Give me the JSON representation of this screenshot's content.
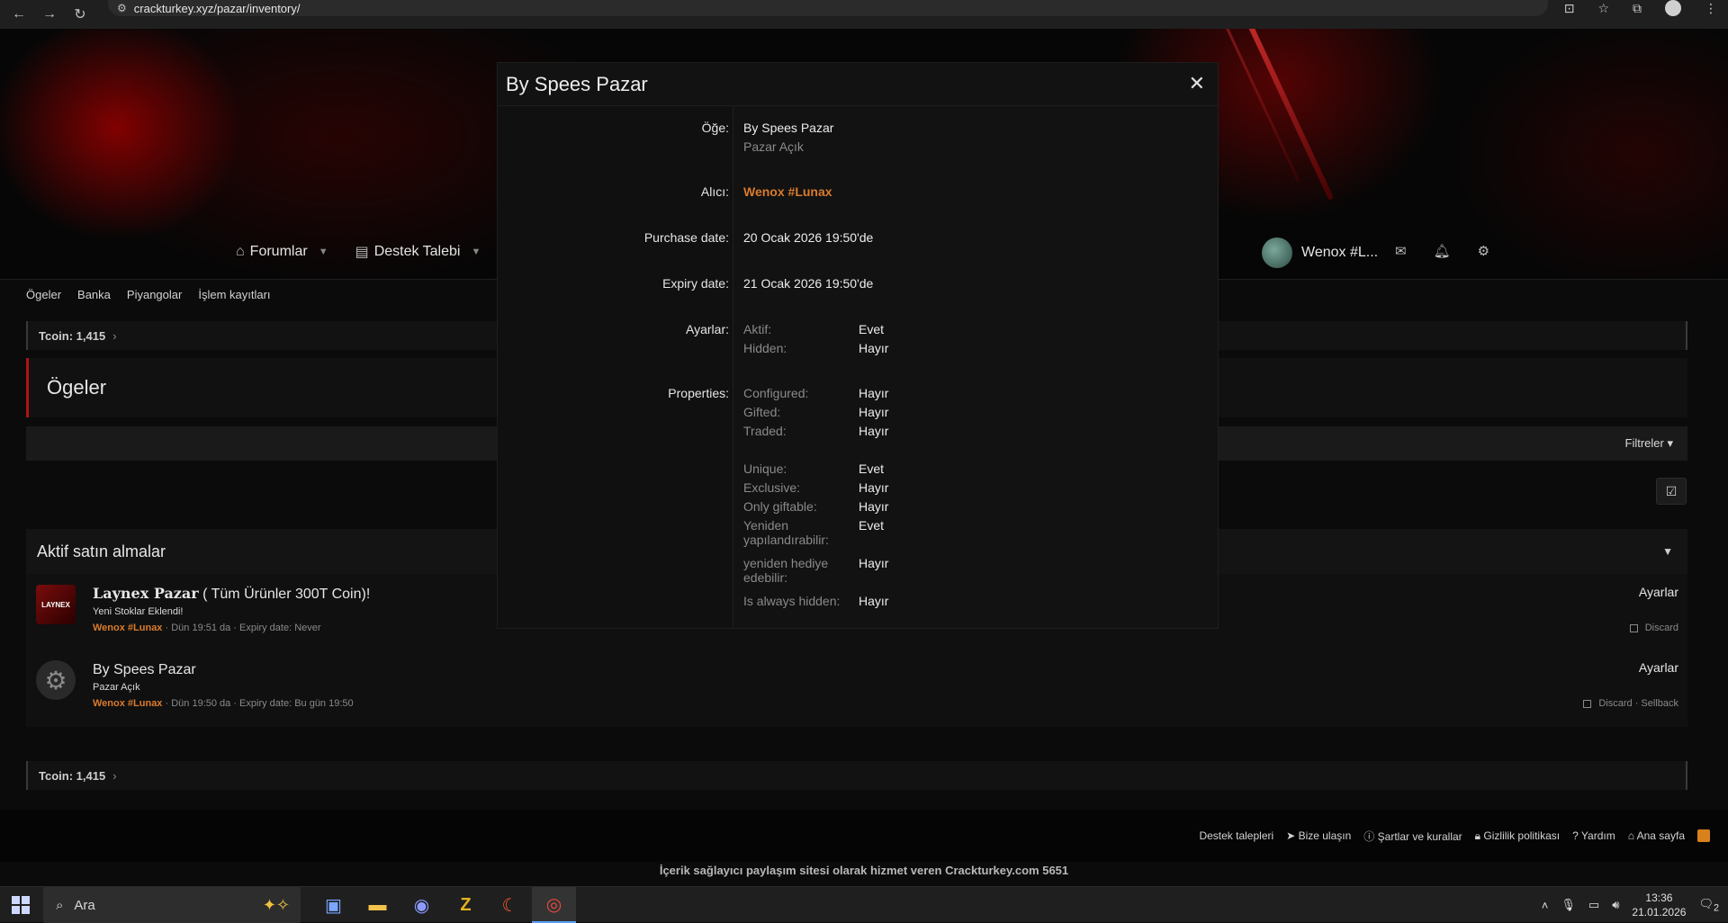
{
  "browser": {
    "url": "crackturkey.xyz/pazar/inventory/"
  },
  "nav": {
    "forums": "Forumlar",
    "support": "Destek Talebi",
    "username": "Wenox #L..."
  },
  "subnav": [
    "Ögeler",
    "Banka",
    "Piyangolar",
    "İşlem kayıtları"
  ],
  "tcoin_top": "Tcoin: 1,415",
  "tcoin_bottom": "Tcoin: 1,415",
  "page_title": "Ögeler",
  "filters": "Filtreler",
  "purchases": {
    "heading": "Aktif satın almalar",
    "items": [
      {
        "title_serif": "Laynex Pazar",
        "title_rest": "( Tüm Ürünler 300T Coin)!",
        "desc": "Yeni Stoklar Eklendi!",
        "user": "Wenox #Lunax",
        "meta": "· Dün 19:51 da · Expiry date: Never",
        "settings": "Ayarlar",
        "actions": "Discard"
      },
      {
        "title_serif": "",
        "title_rest": "By Spees Pazar",
        "desc": "Pazar Açık",
        "user": "Wenox #Lunax",
        "meta": "· Dün 19:50 da · Expiry date: Bu gün 19:50",
        "settings": "Ayarlar",
        "actions": "Discard · Sellback"
      }
    ]
  },
  "footer": {
    "links": [
      "Destek talepleri",
      "Bize ulaşın",
      "Şartlar ve kurallar",
      "Gizlilik politikası",
      "Yardım",
      "Ana sayfa"
    ],
    "text": "İçerik sağlayıcı paylaşım sitesi olarak hizmet veren Crackturkey.com 5651"
  },
  "modal": {
    "title": "By Spees Pazar",
    "labels": {
      "item": "Öğe:",
      "recipient": "Alıcı:",
      "purchase_date": "Purchase date:",
      "expiry_date": "Expiry date:",
      "settings": "Ayarlar:",
      "properties": "Properties:"
    },
    "item_name": "By Spees Pazar",
    "item_desc": "Pazar Açık",
    "recipient": "Wenox #Lunax",
    "purchase_date": "20 Ocak 2026 19:50'de",
    "expiry_date": "21 Ocak 2026 19:50'de",
    "settings": [
      {
        "k": "Aktif:",
        "v": "Evet"
      },
      {
        "k": "Hidden:",
        "v": "Hayır"
      }
    ],
    "properties_a": [
      {
        "k": "Configured:",
        "v": "Hayır"
      },
      {
        "k": "Gifted:",
        "v": "Hayır"
      },
      {
        "k": "Traded:",
        "v": "Hayır"
      }
    ],
    "properties_b": [
      {
        "k": "Unique:",
        "v": "Evet"
      },
      {
        "k": "Exclusive:",
        "v": "Hayır"
      },
      {
        "k": "Only giftable:",
        "v": "Hayır"
      },
      {
        "k": "Yeniden yapılandırabilir:",
        "v": "Evet"
      },
      {
        "k": "yeniden hediye edebilir:",
        "v": "Hayır"
      },
      {
        "k": "Is always hidden:",
        "v": "Hayır"
      }
    ]
  },
  "taskbar": {
    "search": "Ara",
    "time": "13:36",
    "date": "21.01.2026",
    "notifications": "2"
  }
}
